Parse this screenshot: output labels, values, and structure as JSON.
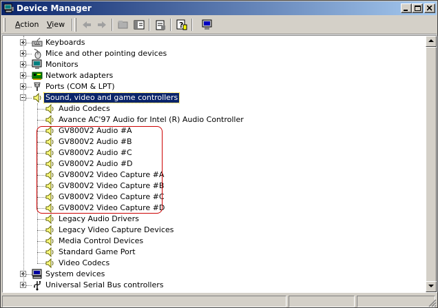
{
  "window": {
    "title": "Device Manager"
  },
  "menu": [
    {
      "label": "Action",
      "underline": "A"
    },
    {
      "label": "View",
      "underline": "V"
    }
  ],
  "toolbar": {
    "buttons": [
      "back-arrow-icon",
      "forward-arrow-icon",
      "up-folder-icon",
      "show-hide-tree-icon",
      "properties-icon",
      "help-icon",
      "scan-hardware-icon"
    ]
  },
  "tree": {
    "categories": [
      {
        "label": "Keyboards",
        "icon": "keyboard-icon",
        "expanded": false
      },
      {
        "label": "Mice and other pointing devices",
        "icon": "mouse-icon",
        "expanded": false
      },
      {
        "label": "Monitors",
        "icon": "monitor-icon",
        "expanded": false
      },
      {
        "label": "Network adapters",
        "icon": "network-adapter-icon",
        "expanded": false
      },
      {
        "label": "Ports (COM & LPT)",
        "icon": "port-icon",
        "expanded": false
      },
      {
        "label": "Sound, video and game controllers",
        "icon": "speaker-icon",
        "expanded": true,
        "selected": true
      },
      {
        "label": "System devices",
        "icon": "computer-icon",
        "expanded": false
      },
      {
        "label": "Universal Serial Bus controllers",
        "icon": "usb-icon",
        "expanded": false
      }
    ],
    "sound_children": [
      "Audio Codecs",
      "Avance AC'97 Audio for Intel (R) Audio Controller",
      "GV800V2 Audio #A",
      "GV800V2 Audio #B",
      "GV800V2 Audio #C",
      "GV800V2 Audio #D",
      "GV800V2 Video Capture #A",
      "GV800V2 Video Capture #B",
      "GV800V2 Video Capture #C",
      "GV800V2 Video Capture #D",
      "Legacy Audio Drivers",
      "Legacy Video Capture Devices",
      "Media Control Devices",
      "Standard Game Port",
      "Video Codecs"
    ]
  },
  "colors": {
    "title_start": "#0a246a",
    "title_end": "#a6caf0",
    "selection": "#0a246a",
    "highlight_box": "#cc0000"
  }
}
